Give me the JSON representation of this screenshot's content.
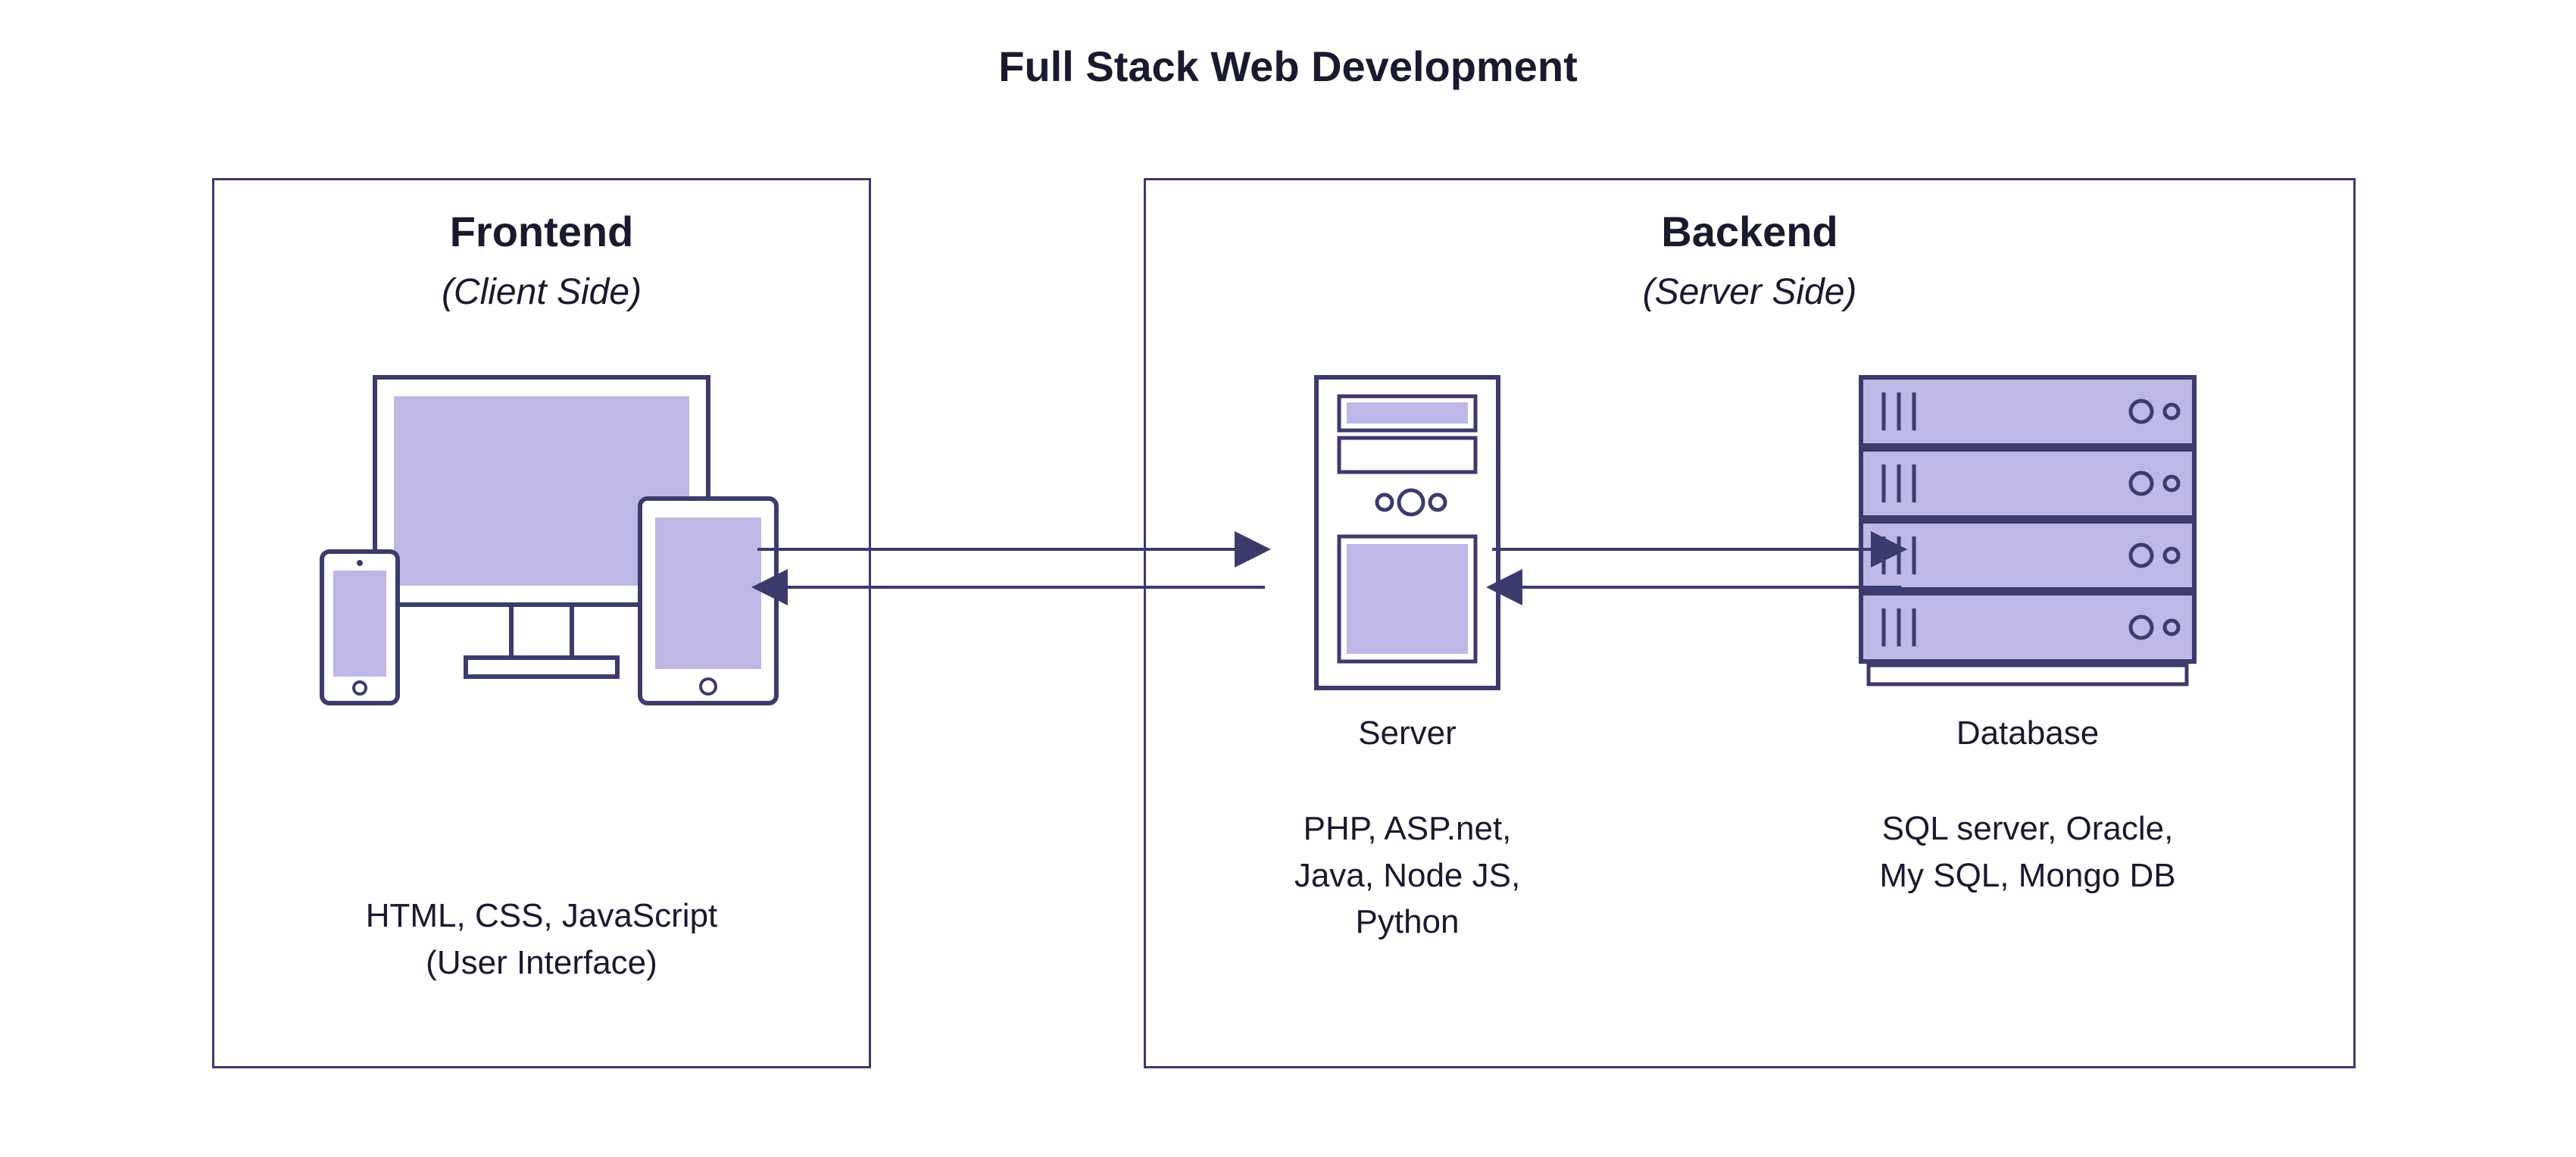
{
  "title": "Full Stack Web Development",
  "frontend": {
    "title": "Frontend",
    "subtitle": "(Client Side)",
    "tech_line1": "HTML, CSS, JavaScript",
    "tech_line2": "(User Interface)"
  },
  "backend": {
    "title": "Backend",
    "subtitle": "(Server Side)",
    "server": {
      "label": "Server",
      "tech_line1": "PHP, ASP.net,",
      "tech_line2": "Java, Node JS,",
      "tech_line3": "Python"
    },
    "database": {
      "label": "Database",
      "tech_line1": "SQL server, Oracle,",
      "tech_line2": "My SQL, Mongo DB"
    }
  },
  "colors": {
    "stroke": "#3b3b6d",
    "fill": "#bdb8e6",
    "text": "#1a1a2e"
  }
}
